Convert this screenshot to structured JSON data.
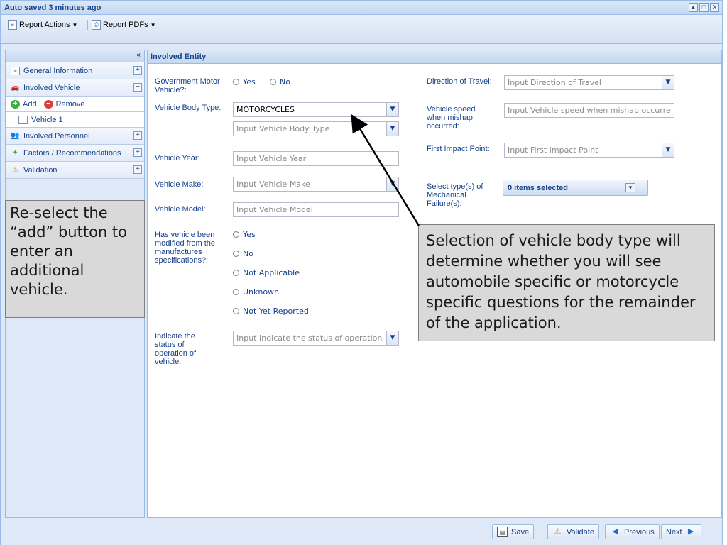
{
  "window": {
    "title": "Auto saved 3 minutes ago",
    "controls": [
      "▲",
      "□",
      "✕"
    ]
  },
  "toolbar": {
    "report_actions": "Report Actions",
    "report_pdfs": "Report PDFs"
  },
  "sidebar": {
    "collapse_glyph": "«",
    "items": [
      {
        "label": "General Information",
        "toggle": "+"
      },
      {
        "label": "Involved Vehicle",
        "toggle": "−"
      },
      {
        "add": "Add",
        "remove": "Remove"
      },
      {
        "label": "Vehicle 1"
      },
      {
        "label": "Involved Personnel",
        "toggle": "+"
      },
      {
        "label": "Factors / Recommendations",
        "toggle": "+"
      },
      {
        "label": "Validation",
        "toggle": "+"
      }
    ]
  },
  "callouts": {
    "left": "Re-select the “add” button to enter an additional vehicle.",
    "right": "Selection of vehicle body type will determine whether you will see automobile specific or motorcycle specific questions for the remainder of the application."
  },
  "main": {
    "header": "Involved Entity",
    "government_label": "Government Motor Vehicle?:",
    "government_options": [
      "Yes",
      "No"
    ],
    "body_type_label": "Vehicle Body Type:",
    "body_type_value": "MOTORCYCLES",
    "body_type_placeholder": "Input Vehicle Body Type",
    "year_label": "Vehicle Year:",
    "year_placeholder": "Input Vehicle Year",
    "make_label": "Vehicle Make:",
    "make_placeholder": "Input Vehicle Make",
    "model_label": "Vehicle Model:",
    "model_placeholder": "Input Vehicle Model",
    "modified_label": "Has vehicle been modified from the manufactures specifications?:",
    "modified_options": [
      "Yes",
      "No",
      "Not Applicable",
      "Unknown",
      "Not Yet Reported"
    ],
    "status_label": "Indicate the status of operation of vehicle:",
    "status_placeholder": "Input Indicate the status of operation",
    "direction_label": "Direction of Travel:",
    "direction_placeholder": "Input Direction of Travel",
    "speed_label": "Vehicle speed when mishap occurred:",
    "speed_placeholder": "Input Vehicle speed when mishap occurre",
    "impact_label": "First Impact Point:",
    "impact_placeholder": "Input First Impact Point",
    "mechanical_label": "Select type(s) of Mechanical Failure(s):",
    "mechanical_value": "0 items selected"
  },
  "footer": {
    "save": "Save",
    "validate": "Validate",
    "previous": "Previous",
    "next": "Next"
  }
}
